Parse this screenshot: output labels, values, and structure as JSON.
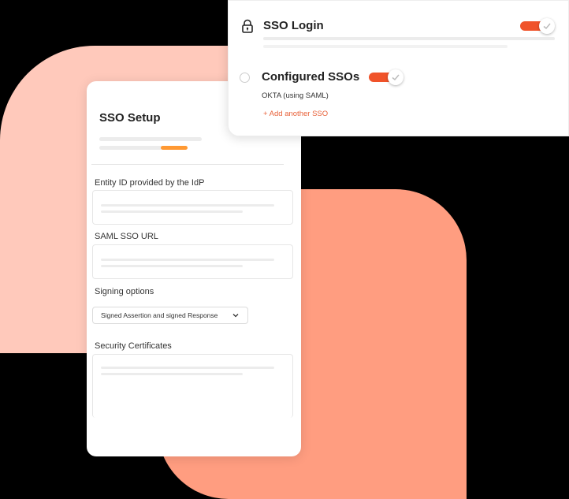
{
  "setup": {
    "title": "SSO Setup",
    "fields": {
      "entity_id_label": "Entity ID provided by the IdP",
      "saml_url_label": "SAML SSO URL",
      "signing_label": "Signing options",
      "signing_value": "Signed Assertion and signed Response",
      "certs_label": "Security Certificates"
    }
  },
  "login": {
    "title": "SSO Login",
    "toggle_on": true,
    "configured_title": "Configured SSOs",
    "configured_toggle_on": true,
    "provider": "OKTA (using SAML)",
    "add_link": "+ Add another SSO"
  },
  "colors": {
    "accent": "#f0532a",
    "progress": "#ff9933",
    "bg_light": "#ffc9bb",
    "bg_dark": "#ff9d80"
  },
  "icons": [
    "lock-icon",
    "check-icon",
    "chevron-down-icon"
  ]
}
